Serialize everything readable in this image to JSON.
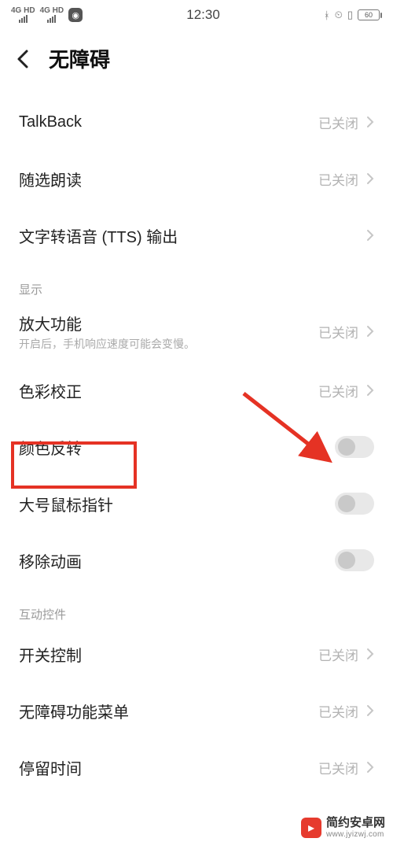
{
  "status_bar": {
    "net_label": "4G HD",
    "time": "12:30",
    "bt": "✱",
    "alarm": "⏰",
    "vibrate": "📳",
    "battery": "60"
  },
  "header": {
    "title": "无障碍"
  },
  "off_label": "已关闭",
  "rows": {
    "talkback": "TalkBack",
    "select_speak": "随选朗读",
    "tts": "文字转语音 (TTS) 输出",
    "section_display": "显示",
    "magnify": "放大功能",
    "magnify_sub": "开启后，手机响应速度可能会变慢。",
    "color_correct": "色彩校正",
    "color_invert": "颜色反转",
    "large_cursor": "大号鼠标指针",
    "remove_anim": "移除动画",
    "section_interact": "互动控件",
    "switch_control": "开关控制",
    "a11y_menu": "无障碍功能菜单",
    "dwell": "停留时间"
  },
  "watermark": {
    "name": "简约安卓网",
    "url": "www.jyizwj.com"
  },
  "colors": {
    "highlight": "#e53224"
  }
}
